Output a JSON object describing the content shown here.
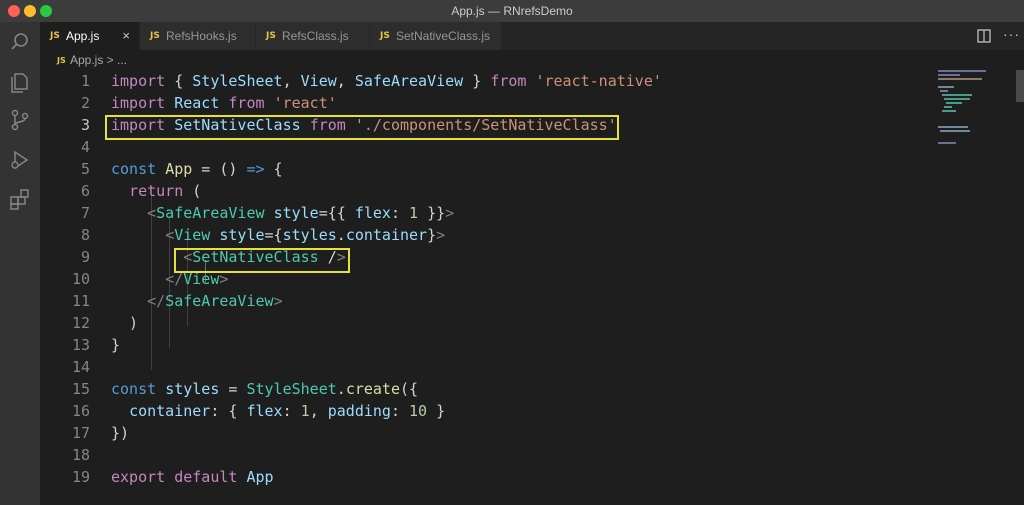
{
  "window": {
    "title": "App.js — RNrefsDemo"
  },
  "tabs": [
    {
      "icon": "JS",
      "label": "App.js",
      "active": true,
      "close": "×"
    },
    {
      "icon": "JS",
      "label": "RefsHooks.js"
    },
    {
      "icon": "JS",
      "label": "RefsClass.js"
    },
    {
      "icon": "JS",
      "label": "SetNativeClass.js"
    }
  ],
  "toolbar": {
    "more": "···"
  },
  "breadcrumb": {
    "icon": "JS",
    "path": "App.js > ..."
  },
  "editor": {
    "current_line": 3,
    "highlighted": [
      "line-3",
      "line-9-tag"
    ],
    "lines": [
      {
        "n": "1",
        "text": "import { StyleSheet, View, SafeAreaView } from 'react-native'"
      },
      {
        "n": "2",
        "text": "import React from 'react'"
      },
      {
        "n": "3",
        "text": "import SetNativeClass from './components/SetNativeClass'"
      },
      {
        "n": "4",
        "text": ""
      },
      {
        "n": "5",
        "text": "const App = () => {"
      },
      {
        "n": "6",
        "text": "  return ("
      },
      {
        "n": "7",
        "text": "    <SafeAreaView style={{ flex: 1 }}>"
      },
      {
        "n": "8",
        "text": "      <View style={styles.container}>"
      },
      {
        "n": "9",
        "text": "        <SetNativeClass />"
      },
      {
        "n": "10",
        "text": "      </View>"
      },
      {
        "n": "11",
        "text": "    </SafeAreaView>"
      },
      {
        "n": "12",
        "text": "  )"
      },
      {
        "n": "13",
        "text": "}"
      },
      {
        "n": "14",
        "text": ""
      },
      {
        "n": "15",
        "text": "const styles = StyleSheet.create({"
      },
      {
        "n": "16",
        "text": "  container: { flex: 1, padding: 10 }"
      },
      {
        "n": "17",
        "text": "})"
      },
      {
        "n": "18",
        "text": ""
      },
      {
        "n": "19",
        "text": "export default App"
      }
    ]
  },
  "colors": {
    "highlight_box": "#e8e03c",
    "js_icon": "#e8c547",
    "editor_bg": "#1e1e1e",
    "keyword": "#c586c0",
    "variable": "#9cdcfe",
    "string": "#ce9178",
    "tag": "#4ec9b0"
  },
  "icons": [
    "files-icon",
    "search-icon",
    "source-control-icon",
    "run-debug-icon",
    "extensions-icon",
    "split-editor-icon",
    "more-actions-icon"
  ]
}
